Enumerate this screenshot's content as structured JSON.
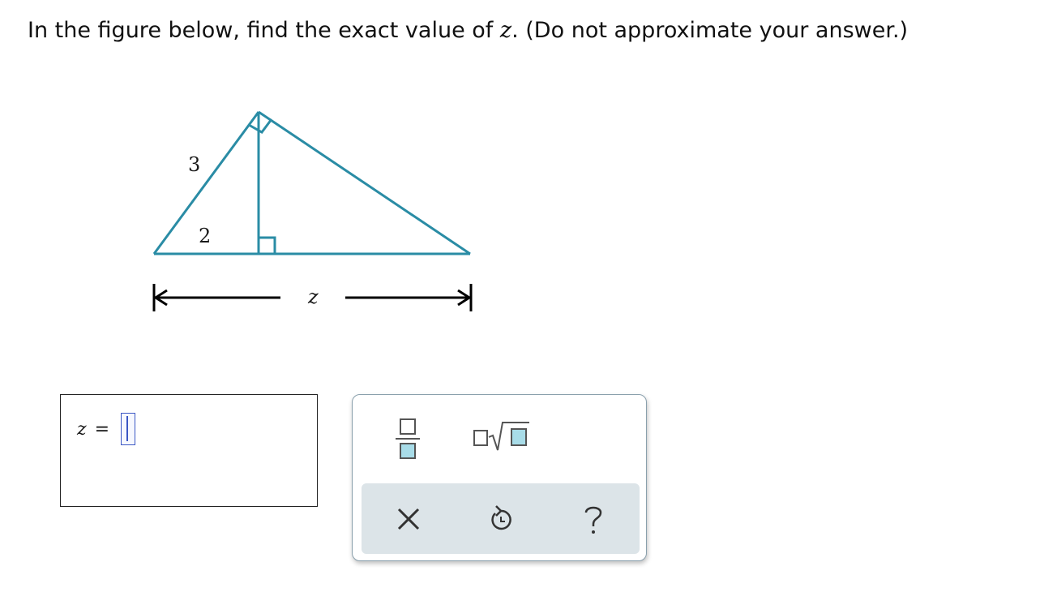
{
  "prompt": {
    "before": "In the figure below, find the exact value of ",
    "variable": "z",
    "after": ". (Do not approximate your answer.)"
  },
  "figure": {
    "label_hypotenuse_left": "3",
    "label_segment_left": "2",
    "label_base": "z",
    "stroke_color": "#2a8ca5"
  },
  "answer": {
    "variable": "z",
    "equals": "=",
    "value": ""
  },
  "toolbar": {
    "buttons": [
      "fraction-icon",
      "mixed-sqrt-icon"
    ],
    "actions": [
      "clear-icon",
      "undo-icon",
      "help-icon"
    ]
  }
}
